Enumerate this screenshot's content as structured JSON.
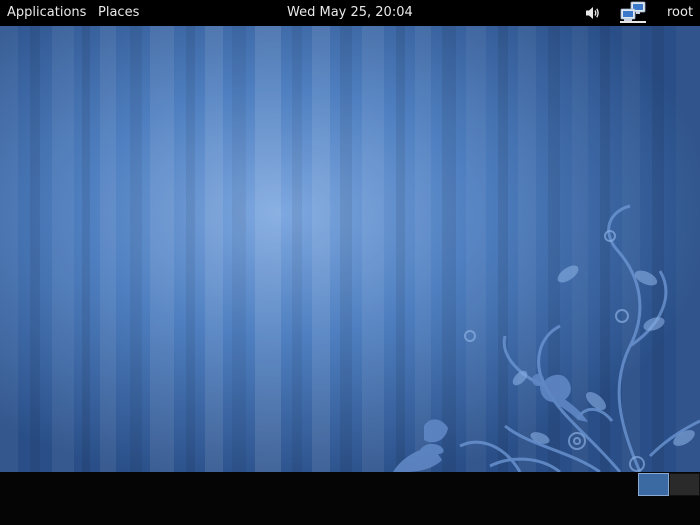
{
  "top_panel": {
    "applications_label": "Applications",
    "places_label": "Places",
    "clock_text": "Wed May 25, 20:04",
    "user_label": "root",
    "volume_icon": "speaker-volume-icon",
    "network_icon": "network-connection-icon"
  },
  "desktop": {
    "wallpaper": "blue vertical stripes with floral vines and birds"
  },
  "bottom_panel": {
    "workspaces": [
      {
        "active": true
      },
      {
        "active": false
      }
    ]
  },
  "colors": {
    "panel_bg": "#000000",
    "wallpaper_base": "#2f5792",
    "wallpaper_light": "#7ea8e0",
    "active_workspace": "#3b6aa3"
  }
}
